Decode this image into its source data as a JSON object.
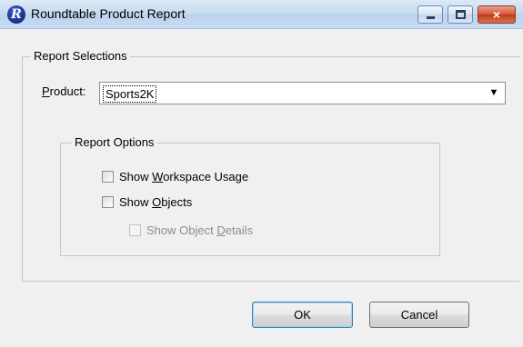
{
  "window": {
    "title": "Roundtable Product Report",
    "icon": "roundtable-app-icon",
    "controls": {
      "minimize": "minimize-icon",
      "maximize": "maximize-icon",
      "close": "×"
    }
  },
  "report_selections": {
    "legend": "Report Selections",
    "product": {
      "label_accel": "P",
      "label_rest": "roduct:",
      "value": "Sports2K"
    },
    "report_options": {
      "legend": "Report Options",
      "options": [
        {
          "pre": "Show ",
          "accel": "W",
          "post": "orkspace Usage",
          "checked": false,
          "enabled": true
        },
        {
          "pre": "Show ",
          "accel": "O",
          "post": "bjects",
          "checked": false,
          "enabled": true
        },
        {
          "pre": "Show Object ",
          "accel": "D",
          "post": "etails",
          "checked": false,
          "enabled": false
        }
      ]
    }
  },
  "buttons": {
    "ok_label": "OK",
    "cancel_label": "Cancel"
  },
  "colors": {
    "titlebar": "#c9dcf1",
    "close_button": "#c2391b",
    "dialog_background": "#f0f0f0"
  }
}
